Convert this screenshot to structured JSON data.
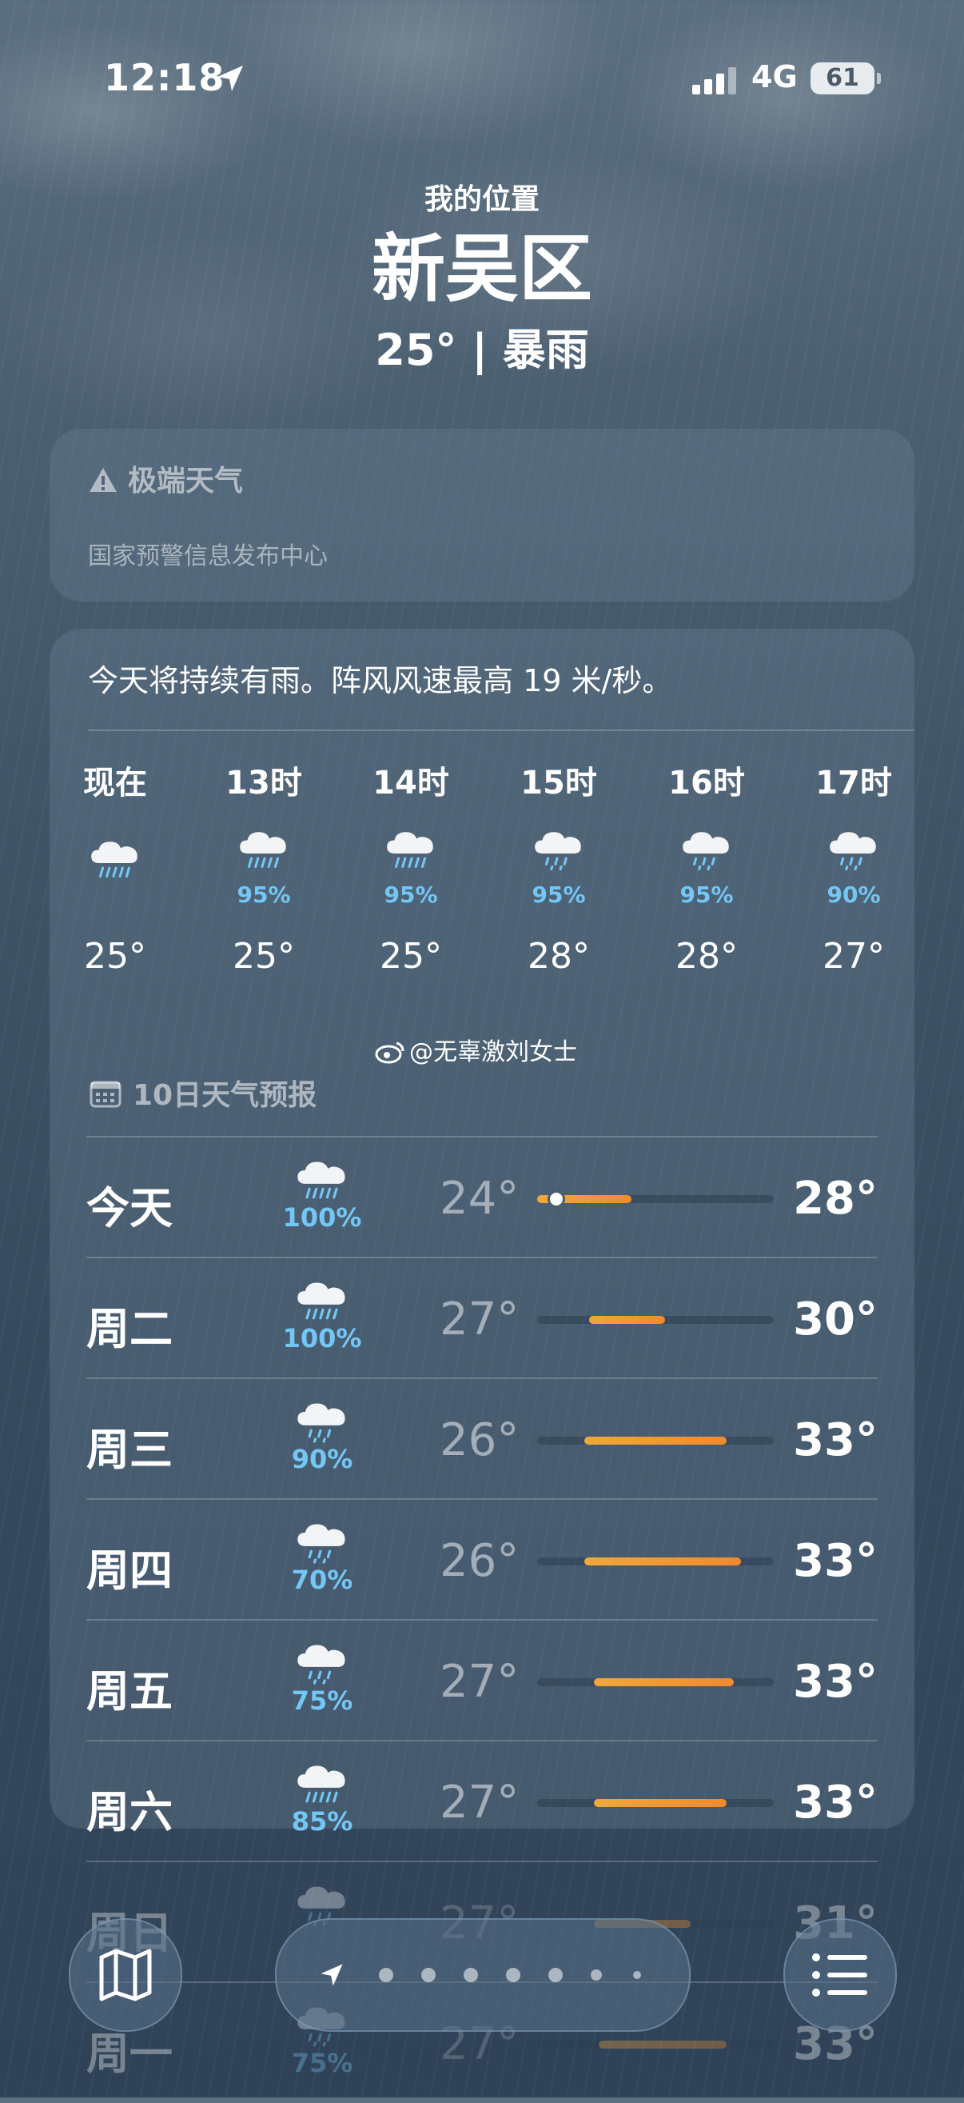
{
  "status_bar": {
    "time": "12:18",
    "network": "4G",
    "battery": "61"
  },
  "header": {
    "subtitle": "我的位置",
    "city": "新吴区",
    "current": "25° | 暴雨"
  },
  "alert": {
    "title": "极端天气",
    "source": "国家预警信息发布中心"
  },
  "forecast": {
    "summary": "今天将持续有雨。阵风风速最高 19 米/秒。",
    "hourly": [
      {
        "label": "现在",
        "precip": "",
        "temp": "25°",
        "icon": "rain-cloud-icon"
      },
      {
        "label": "13时",
        "precip": "95%",
        "temp": "25°",
        "icon": "heavy-rain-cloud-icon"
      },
      {
        "label": "14时",
        "precip": "95%",
        "temp": "25°",
        "icon": "heavy-rain-cloud-icon"
      },
      {
        "label": "15时",
        "precip": "95%",
        "temp": "28°",
        "icon": "rain-cloud-icon"
      },
      {
        "label": "16时",
        "precip": "95%",
        "temp": "28°",
        "icon": "rain-cloud-icon"
      },
      {
        "label": "17时",
        "precip": "90%",
        "temp": "27°",
        "icon": "rain-cloud-icon"
      }
    ]
  },
  "watermark": "@无辜激刘女士",
  "ten_day": {
    "title": "10日天气预报",
    "days": [
      {
        "day": "今天",
        "precip": "100%",
        "low": "24°",
        "high": "28°",
        "bar_start": 0.0,
        "bar_end": 0.4,
        "current_marker": 0.08
      },
      {
        "day": "周二",
        "precip": "100%",
        "low": "27°",
        "high": "30°",
        "bar_start": 0.22,
        "bar_end": 0.54
      },
      {
        "day": "周三",
        "precip": "90%",
        "low": "26°",
        "high": "33°",
        "bar_start": 0.2,
        "bar_end": 0.8
      },
      {
        "day": "周四",
        "precip": "70%",
        "low": "26°",
        "high": "33°",
        "bar_start": 0.2,
        "bar_end": 0.86
      },
      {
        "day": "周五",
        "precip": "75%",
        "low": "27°",
        "high": "33°",
        "bar_start": 0.24,
        "bar_end": 0.83
      },
      {
        "day": "周六",
        "precip": "85%",
        "low": "27°",
        "high": "33°",
        "bar_start": 0.24,
        "bar_end": 0.8
      },
      {
        "day": "周日",
        "precip": "",
        "low": "27°",
        "high": "31°",
        "bar_start": 0.24,
        "bar_end": 0.65
      },
      {
        "day": "周一",
        "precip": "75%",
        "low": "27°",
        "high": "33°",
        "bar_start": 0.26,
        "bar_end": 0.8
      }
    ]
  },
  "bottom_bar": {
    "map_icon": "map-icon",
    "list_icon": "list-icon",
    "page_count": 8,
    "current_page": 0
  }
}
